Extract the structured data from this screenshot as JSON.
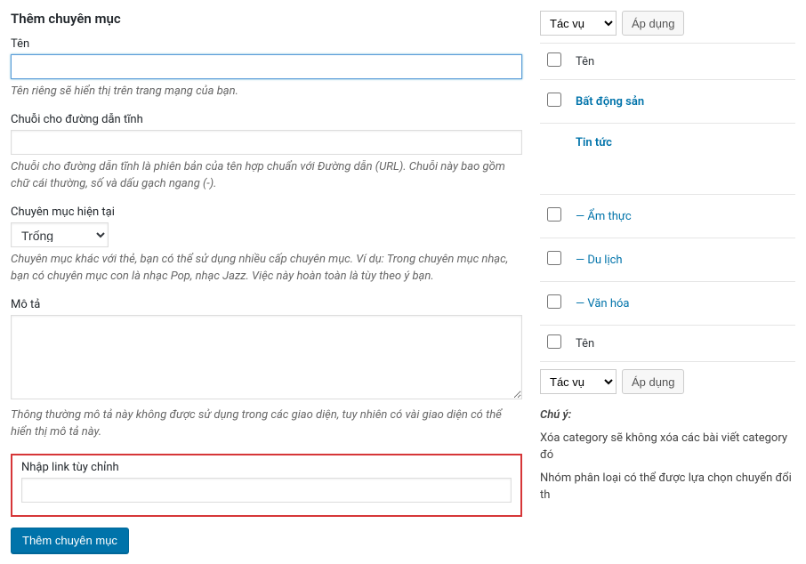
{
  "form": {
    "heading": "Thêm chuyên mục",
    "name_label": "Tên",
    "name_value": "",
    "name_desc": "Tên riêng sẽ hiển thị trên trang mạng của bạn.",
    "slug_label": "Chuỗi cho đường dẫn tĩnh",
    "slug_value": "",
    "slug_desc": "Chuỗi cho đường dẫn tĩnh là phiên bản của tên hợp chuẩn với Đường dẫn (URL). Chuỗi này bao gồm chữ cái thường, số và dấu gạch ngang (-).",
    "parent_label": "Chuyên mục hiện tại",
    "parent_selected": "Trống",
    "parent_desc": "Chuyên mục khác với thẻ, bạn có thể sử dụng nhiều cấp chuyên mục. Ví dụ: Trong chuyên mục nhạc, bạn có chuyên mục con là nhạc Pop, nhạc Jazz. Việc này hoàn toàn là tùy theo ý bạn.",
    "desc_label": "Mô tả",
    "desc_value": "",
    "desc_desc": "Thông thường mô tả này không được sử dụng trong các giao diện, tuy nhiên có vài giao diện có thể hiển thị mô tả này.",
    "customlink_label": "Nhập link tùy chỉnh",
    "customlink_value": "",
    "submit_label": "Thêm chuyên mục"
  },
  "table": {
    "bulk_selected": "Tác vụ",
    "apply_label": "Áp dụng",
    "col_name": "Tên",
    "rows": [
      {
        "label": "Bất động sản",
        "indent": 0
      },
      {
        "label": "Tin tức",
        "indent": 0,
        "nocb": true
      },
      {
        "label": "— Ẩm thực",
        "indent": 1
      },
      {
        "label": "— Du lịch",
        "indent": 1
      },
      {
        "label": "— Văn hóa",
        "indent": 1
      }
    ]
  },
  "note": {
    "title": "Chú ý:",
    "line1": "Xóa category sẽ không xóa các bài viết category đó",
    "line2": "Nhóm phân loại có thể được lựa chọn chuyển đổi th"
  }
}
